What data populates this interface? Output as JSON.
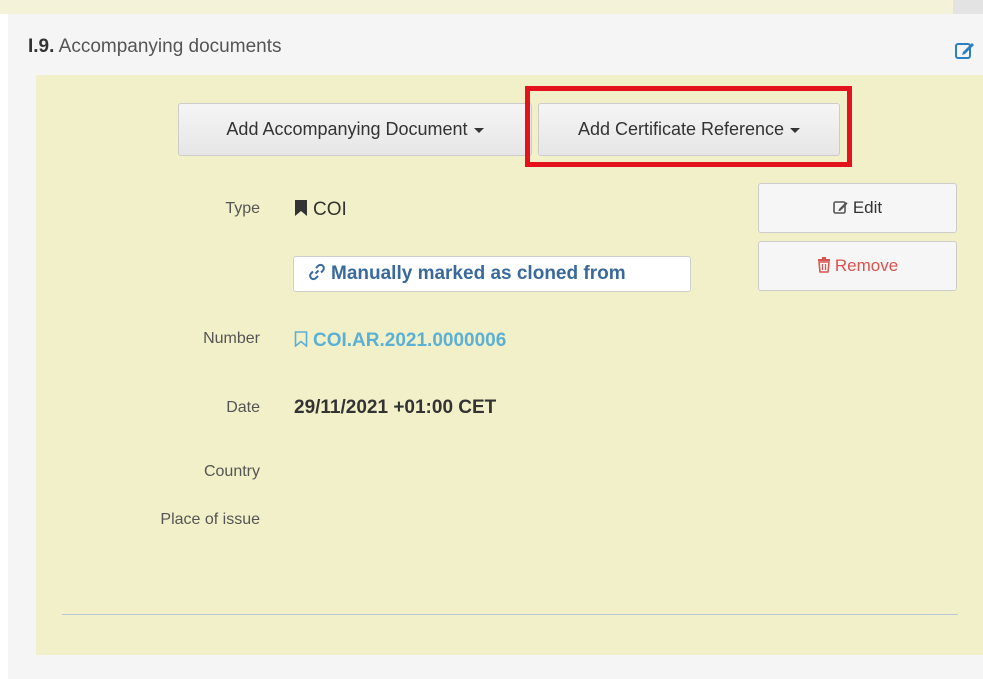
{
  "section": {
    "number": "I.9.",
    "title": "Accompanying documents"
  },
  "buttons": {
    "add_document": "Add Accompanying Document",
    "add_certificate": "Add Certificate Reference",
    "edit": "Edit",
    "remove": "Remove"
  },
  "fields": {
    "type_label": "Type",
    "type_value": "COI",
    "cloned_badge": "Manually marked as cloned from",
    "number_label": "Number",
    "number_value": "COI.AR.2021.0000006",
    "date_label": "Date",
    "date_value": "29/11/2021 +01:00 CET",
    "country_label": "Country",
    "country_value": "",
    "place_label": "Place of issue",
    "place_value": ""
  },
  "colors": {
    "section_background": "#f2f0c8",
    "highlight": "#e3121c",
    "link": "#5bb0d4",
    "badge_text": "#3a6a9c",
    "remove_text": "#d9534f"
  },
  "icons": {
    "header_edit": "edit-square-icon",
    "type": "bookmark-filled-icon",
    "badge": "link-icon",
    "number": "bookmark-outline-icon",
    "edit": "edit-square-icon",
    "remove": "trash-icon"
  }
}
